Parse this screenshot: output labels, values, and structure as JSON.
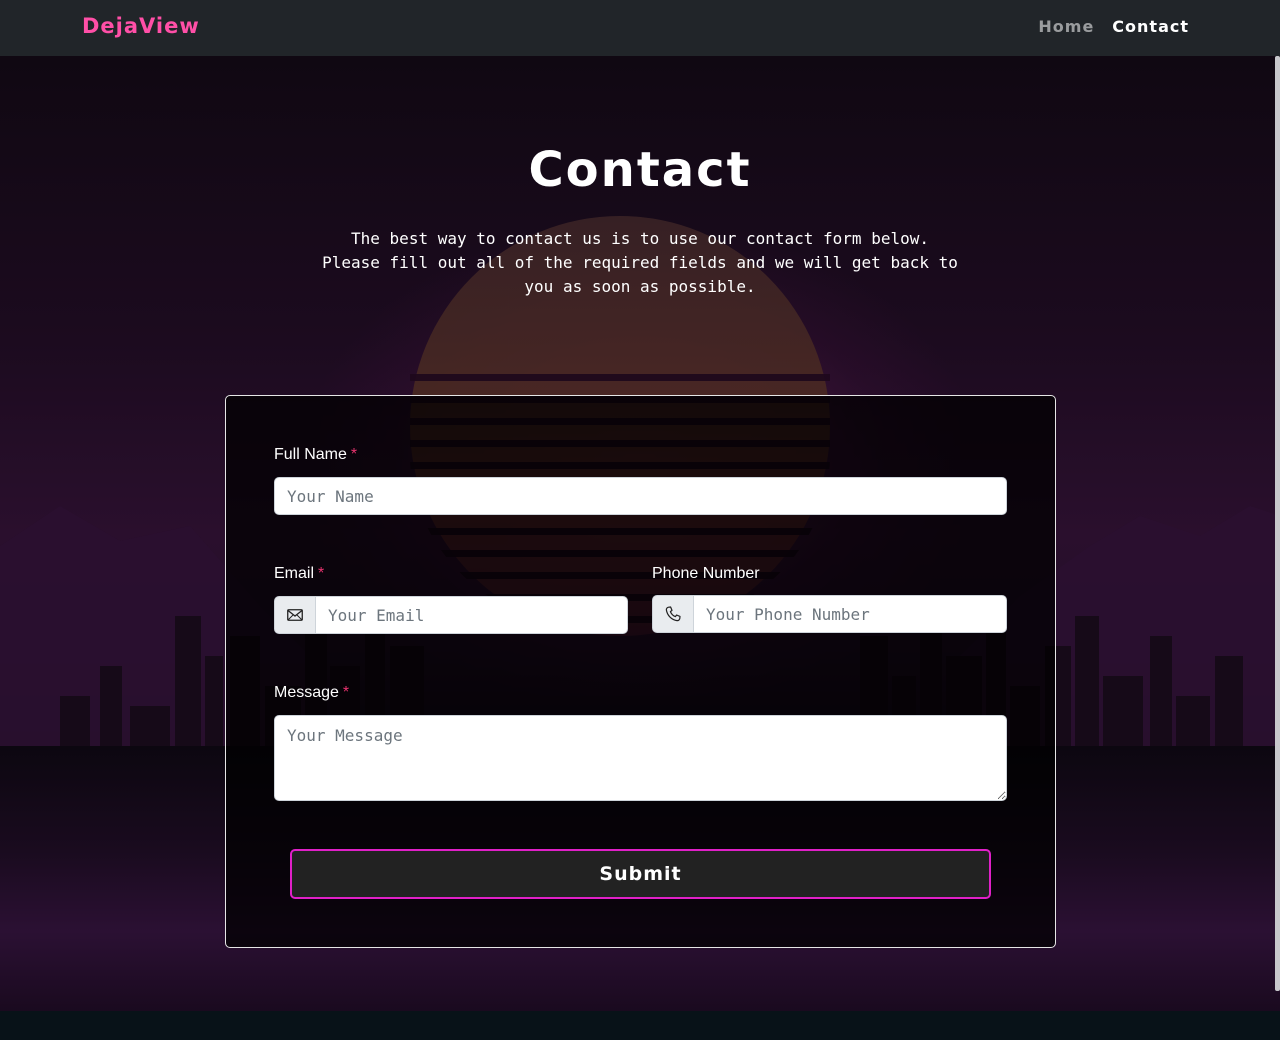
{
  "navbar": {
    "brand": "DejaView",
    "links": [
      {
        "label": "Home",
        "active": false
      },
      {
        "label": "Contact",
        "active": true
      }
    ]
  },
  "page": {
    "title": "Contact",
    "subtitle": "The best way to contact us is to use our contact form below. Please fill out all of the required fields and we will get back to you as soon as possible."
  },
  "form": {
    "full_name": {
      "label": "Full Name",
      "required_mark": "*",
      "placeholder": "Your Name",
      "value": ""
    },
    "email": {
      "label": "Email",
      "required_mark": "*",
      "placeholder": "Your Email",
      "value": "",
      "icon": "envelope-icon"
    },
    "phone": {
      "label": "Phone Number",
      "placeholder": "Your Phone Number",
      "value": "",
      "icon": "phone-icon"
    },
    "message": {
      "label": "Message",
      "required_mark": "*",
      "placeholder": "Your Message",
      "value": ""
    },
    "submit_label": "Submit"
  },
  "colors": {
    "brand": "#ff4fa7",
    "required": "#e8336f",
    "submit_border": "#e020c8",
    "navbar_bg": "#212529"
  }
}
